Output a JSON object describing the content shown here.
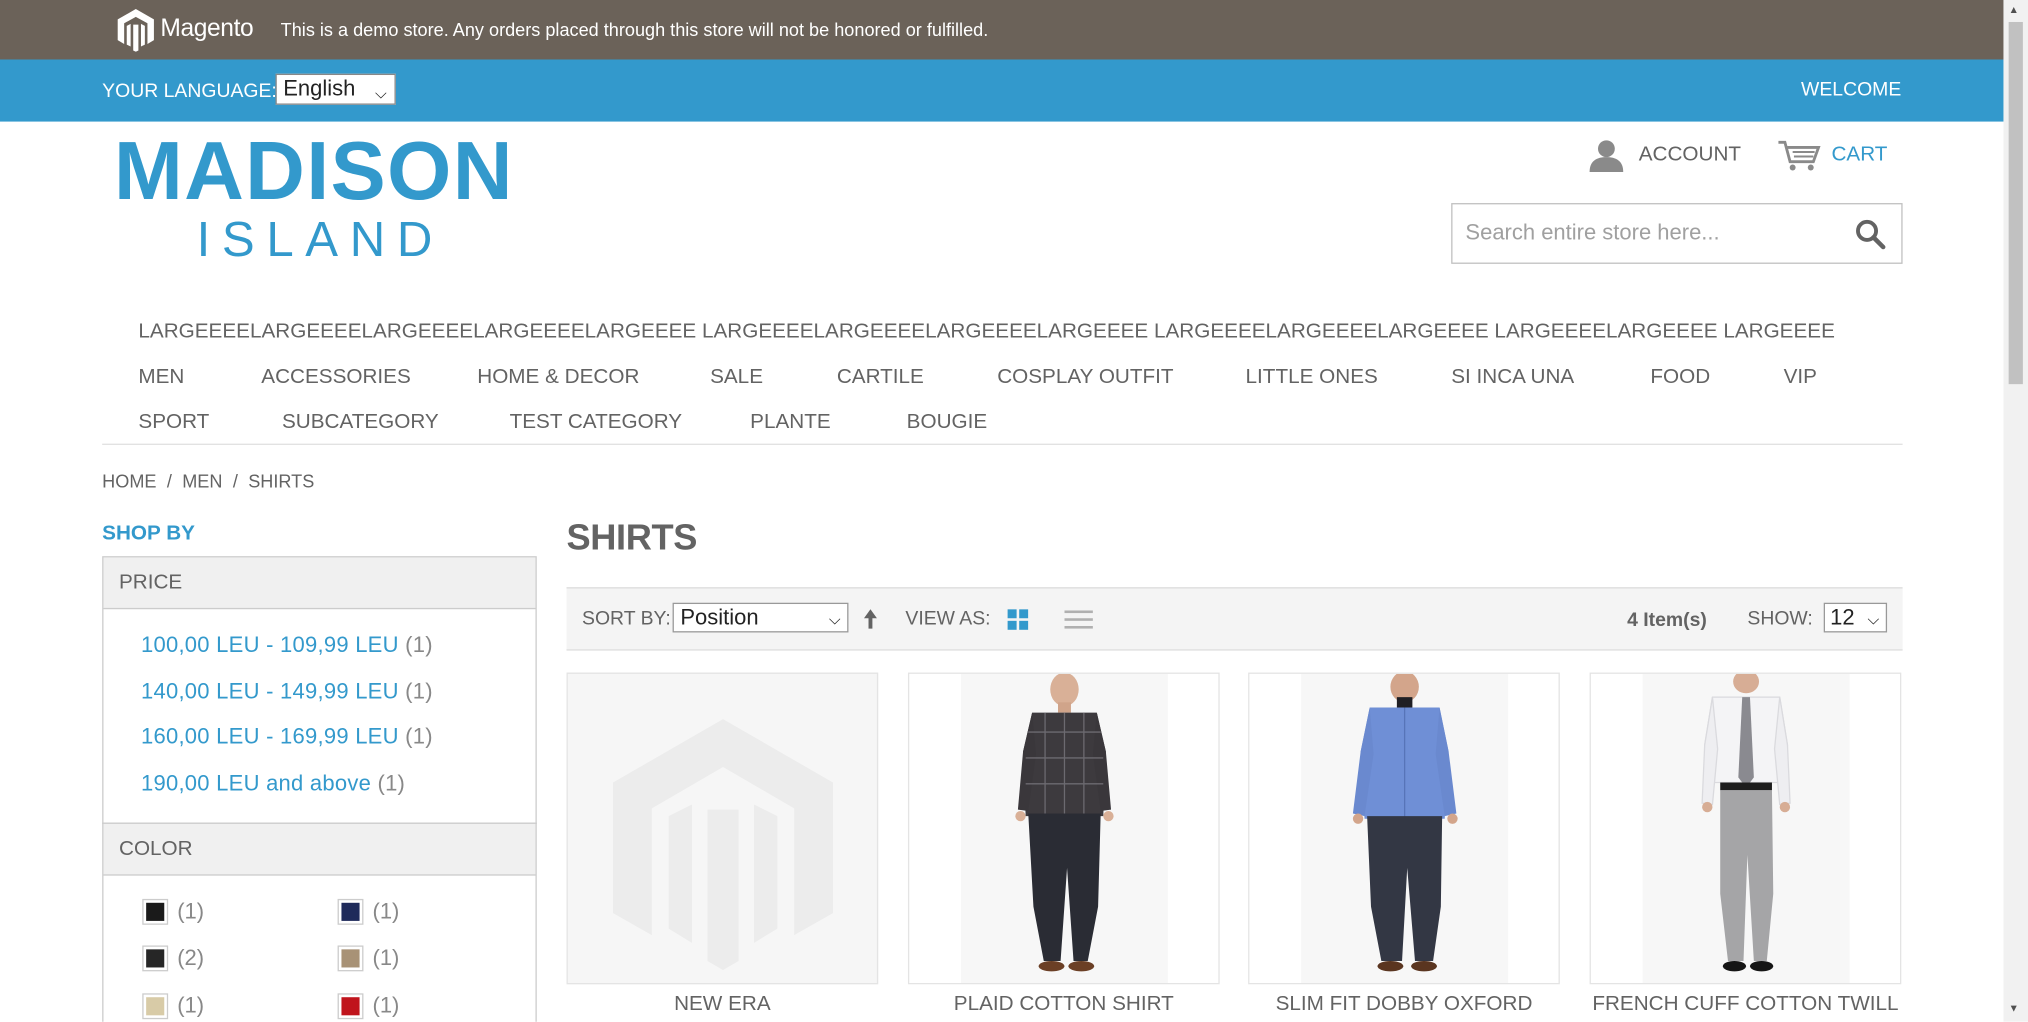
{
  "demo_notice": {
    "logo_text": "Magento",
    "text": "This is a demo store. Any orders placed through this store will not be honored or fulfilled."
  },
  "header": {
    "language_label": "YOUR LANGUAGE:",
    "language_value": "English",
    "welcome": "WELCOME",
    "logo_main": "MADISON",
    "logo_sub": "ISLAND",
    "account_label": "ACCOUNT",
    "cart_label": "CART",
    "search_placeholder": "Search entire store here..."
  },
  "nav": {
    "long_item": "LARGEEEELARGEEEELARGEEEELARGEEEELARGEEEE LARGEEEELARGEEEELARGEEEELARGEEEE LARGEEEELARGEEEELARGEEEE LARGEEEELARGEEEE LARGEEEE",
    "row1": [
      "MEN",
      "ACCESSORIES",
      "HOME & DECOR",
      "SALE",
      "CARTILE",
      "COSPLAY OUTFIT",
      "LITTLE ONES",
      "SI INCA UNA",
      "FOOD",
      "VIP"
    ],
    "row2": [
      "SPORT",
      "SUBCATEGORY",
      "TEST CATEGORY",
      "PLANTE",
      "BOUGIE"
    ]
  },
  "breadcrumb": {
    "items": [
      "HOME",
      "MEN",
      "SHIRTS"
    ],
    "separator": "/"
  },
  "sidebar": {
    "title": "SHOP BY",
    "price": {
      "heading": "PRICE",
      "items": [
        {
          "label": "100,00 LEU - 109,99 LEU",
          "count": "(1)"
        },
        {
          "label": "140,00 LEU - 149,99 LEU",
          "count": "(1)"
        },
        {
          "label": "160,00 LEU - 169,99 LEU",
          "count": "(1)"
        },
        {
          "label": "190,00 LEU and above",
          "count": "(1)"
        }
      ]
    },
    "color": {
      "heading": "COLOR",
      "items": [
        {
          "color": "#1a1a1a",
          "count": "(1)"
        },
        {
          "color": "#1e2a5a",
          "count": "(1)"
        },
        {
          "color": "#262626",
          "count": "(2)"
        },
        {
          "color": "#a89276",
          "count": "(1)"
        },
        {
          "color": "#d8cba7",
          "count": "(1)"
        },
        {
          "color": "#c0141c",
          "count": "(1)"
        }
      ]
    }
  },
  "main": {
    "title": "SHIRTS",
    "toolbar": {
      "sort_label": "SORT BY:",
      "sort_value": "Position",
      "view_label": "VIEW AS:",
      "items_count": "4 Item(s)",
      "show_label": "SHOW:",
      "show_value": "12"
    },
    "products": [
      {
        "name": "NEW ERA",
        "image": "placeholder"
      },
      {
        "name": "PLAID COTTON SHIRT",
        "image": "plaid-shirt"
      },
      {
        "name": "SLIM FIT DOBBY OXFORD",
        "image": "blue-shirt"
      },
      {
        "name": "FRENCH CUFF COTTON TWILL",
        "image": "white-shirt"
      }
    ]
  },
  "colors": {
    "accent": "#3399cc",
    "demo_bar": "#6b6259",
    "text": "#636363"
  }
}
